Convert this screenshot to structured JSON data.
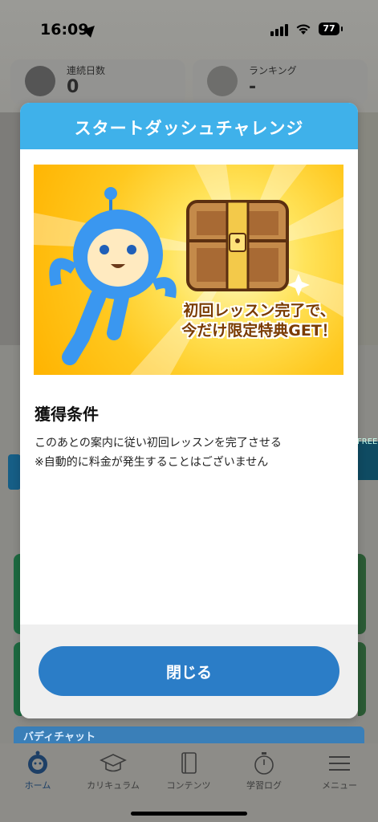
{
  "status_bar": {
    "time": "16:09",
    "battery": "77"
  },
  "stats": {
    "streak_label": "連続日数",
    "streak_value": "0",
    "ranking_label": "ランキング",
    "ranking_value": "-"
  },
  "background": {
    "free_tag": "FREE",
    "buddy_chat_label": "バディチャット"
  },
  "modal": {
    "title": "スタートダッシュチャレンジ",
    "banner_line1": "初回レッスン完了で、",
    "banner_line2": "今だけ限定特典GET！",
    "section_title": "獲得条件",
    "condition_1": "このあとの案内に従い初回レッスンを完了させる",
    "condition_2": "※自動的に料金が発生することはございません",
    "close_label": "閉じる"
  },
  "tabs": [
    {
      "label": "ホーム",
      "icon": "robot-home-icon",
      "active": true
    },
    {
      "label": "カリキュラム",
      "icon": "graduation-cap-icon",
      "active": false
    },
    {
      "label": "コンテンツ",
      "icon": "book-icon",
      "active": false
    },
    {
      "label": "学習ログ",
      "icon": "stopwatch-icon",
      "active": false
    },
    {
      "label": "メニュー",
      "icon": "hamburger-menu-icon",
      "active": false
    }
  ],
  "colors": {
    "header": "#3fb1ea",
    "button": "#2b7dc7",
    "overlay": "#8a8a86"
  }
}
